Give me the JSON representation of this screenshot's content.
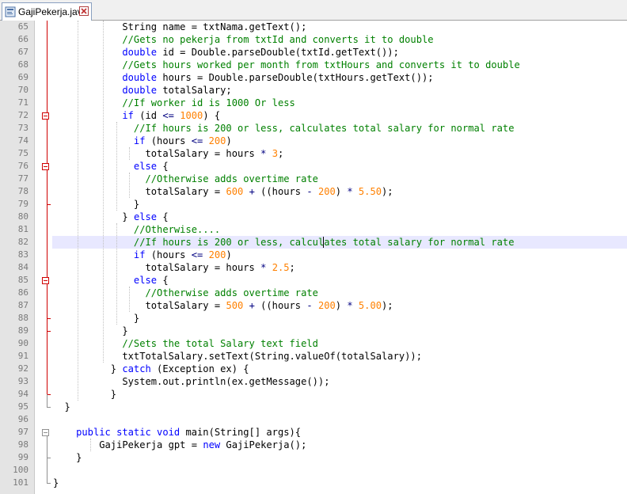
{
  "tab": {
    "label": "GajiPekerja.java",
    "icon": "java-file-icon",
    "close_icon": "close-icon"
  },
  "colors": {
    "keyword": "#0000ff",
    "comment": "#008000",
    "number": "#ff8000",
    "operator": "#000080",
    "fold_marker": "#d00000",
    "current_line": "#e8e8ff"
  },
  "editor": {
    "current_line": 82,
    "lines": [
      {
        "n": "65",
        "segs": [
          [
            "tx",
            "            String name = txtNama.getText();"
          ]
        ]
      },
      {
        "n": "66",
        "segs": [
          [
            "cm",
            "            //Gets no pekerja from txtId and converts it to double"
          ]
        ]
      },
      {
        "n": "67",
        "segs": [
          [
            "kw",
            "            double"
          ],
          [
            "tx",
            " id = Double.parseDouble(txtId.getText());"
          ]
        ]
      },
      {
        "n": "68",
        "segs": [
          [
            "cm",
            "            //Gets hours worked per month from txtHours and converts it to double"
          ]
        ]
      },
      {
        "n": "69",
        "segs": [
          [
            "kw",
            "            double"
          ],
          [
            "tx",
            " hours = Double.parseDouble(txtHours.getText());"
          ]
        ]
      },
      {
        "n": "70",
        "segs": [
          [
            "kw",
            "            double"
          ],
          [
            "tx",
            " totalSalary;"
          ]
        ]
      },
      {
        "n": "71",
        "segs": [
          [
            "cm",
            "            //If worker id is 1000 Or less"
          ]
        ]
      },
      {
        "n": "72",
        "segs": [
          [
            "kw",
            "            if"
          ],
          [
            "tx",
            " (id "
          ],
          [
            "op",
            "<="
          ],
          [
            "tx",
            " "
          ],
          [
            "nm",
            "1000"
          ],
          [
            "tx",
            ") {"
          ]
        ]
      },
      {
        "n": "73",
        "segs": [
          [
            "cm",
            "              //If hours is 200 or less, calculates total salary for normal rate"
          ]
        ]
      },
      {
        "n": "74",
        "segs": [
          [
            "kw",
            "              if"
          ],
          [
            "tx",
            " (hours "
          ],
          [
            "op",
            "<="
          ],
          [
            "tx",
            " "
          ],
          [
            "nm",
            "200"
          ],
          [
            "tx",
            ")"
          ]
        ]
      },
      {
        "n": "75",
        "segs": [
          [
            "tx",
            "                totalSalary = hours "
          ],
          [
            "op",
            "*"
          ],
          [
            "tx",
            " "
          ],
          [
            "nm",
            "3"
          ],
          [
            "tx",
            ";"
          ]
        ]
      },
      {
        "n": "76",
        "segs": [
          [
            "kw",
            "              else"
          ],
          [
            "tx",
            " {"
          ]
        ]
      },
      {
        "n": "77",
        "segs": [
          [
            "cm",
            "                //Otherwise adds overtime rate"
          ]
        ]
      },
      {
        "n": "78",
        "segs": [
          [
            "tx",
            "                totalSalary = "
          ],
          [
            "nm",
            "600"
          ],
          [
            "tx",
            " "
          ],
          [
            "op",
            "+"
          ],
          [
            "tx",
            " ((hours "
          ],
          [
            "op",
            "-"
          ],
          [
            "tx",
            " "
          ],
          [
            "nm",
            "200"
          ],
          [
            "tx",
            ") "
          ],
          [
            "op",
            "*"
          ],
          [
            "tx",
            " "
          ],
          [
            "nm",
            "5.50"
          ],
          [
            "tx",
            ");"
          ]
        ]
      },
      {
        "n": "79",
        "segs": [
          [
            "tx",
            "              }"
          ]
        ]
      },
      {
        "n": "80",
        "segs": [
          [
            "tx",
            "            } "
          ],
          [
            "kw",
            "else"
          ],
          [
            "tx",
            " {"
          ]
        ]
      },
      {
        "n": "81",
        "segs": [
          [
            "cm",
            "              //Otherwise...."
          ]
        ]
      },
      {
        "n": "82",
        "segs": [
          [
            "cm",
            "              //If hours is 200 or less, calculates total salary for normal rate"
          ]
        ]
      },
      {
        "n": "83",
        "segs": [
          [
            "kw",
            "              if"
          ],
          [
            "tx",
            " (hours "
          ],
          [
            "op",
            "<="
          ],
          [
            "tx",
            " "
          ],
          [
            "nm",
            "200"
          ],
          [
            "tx",
            ")"
          ]
        ]
      },
      {
        "n": "84",
        "segs": [
          [
            "tx",
            "                totalSalary = hours "
          ],
          [
            "op",
            "*"
          ],
          [
            "tx",
            " "
          ],
          [
            "nm",
            "2.5"
          ],
          [
            "tx",
            ";"
          ]
        ]
      },
      {
        "n": "85",
        "segs": [
          [
            "kw",
            "              else"
          ],
          [
            "tx",
            " {"
          ]
        ]
      },
      {
        "n": "86",
        "segs": [
          [
            "cm",
            "                //Otherwise adds overtime rate"
          ]
        ]
      },
      {
        "n": "87",
        "segs": [
          [
            "tx",
            "                totalSalary = "
          ],
          [
            "nm",
            "500"
          ],
          [
            "tx",
            " "
          ],
          [
            "op",
            "+"
          ],
          [
            "tx",
            " ((hours "
          ],
          [
            "op",
            "-"
          ],
          [
            "tx",
            " "
          ],
          [
            "nm",
            "200"
          ],
          [
            "tx",
            ") "
          ],
          [
            "op",
            "*"
          ],
          [
            "tx",
            " "
          ],
          [
            "nm",
            "5.00"
          ],
          [
            "tx",
            ");"
          ]
        ]
      },
      {
        "n": "88",
        "segs": [
          [
            "tx",
            "              }"
          ]
        ]
      },
      {
        "n": "89",
        "segs": [
          [
            "tx",
            "            }"
          ]
        ]
      },
      {
        "n": "90",
        "segs": [
          [
            "cm",
            "            //Sets the total Salary text field"
          ]
        ]
      },
      {
        "n": "91",
        "segs": [
          [
            "tx",
            "            txtTotalSalary.setText(String.valueOf(totalSalary));"
          ]
        ]
      },
      {
        "n": "92",
        "segs": [
          [
            "tx",
            "          } "
          ],
          [
            "kw",
            "catch"
          ],
          [
            "tx",
            " (Exception ex) {"
          ]
        ]
      },
      {
        "n": "93",
        "segs": [
          [
            "tx",
            "            System.out.println(ex.getMessage());"
          ]
        ]
      },
      {
        "n": "94",
        "segs": [
          [
            "tx",
            "          }"
          ]
        ]
      },
      {
        "n": "95",
        "segs": [
          [
            "tx",
            "  }"
          ]
        ]
      },
      {
        "n": "96",
        "segs": [
          [
            "tx",
            ""
          ]
        ]
      },
      {
        "n": "97",
        "segs": [
          [
            "kw",
            "    public static void"
          ],
          [
            "tx",
            " main(String[] args){"
          ]
        ]
      },
      {
        "n": "98",
        "segs": [
          [
            "tx",
            "        GajiPekerja gpt = "
          ],
          [
            "kw",
            "new"
          ],
          [
            "tx",
            " GajiPekerja();"
          ]
        ]
      },
      {
        "n": "99",
        "segs": [
          [
            "tx",
            "    }"
          ]
        ]
      },
      {
        "n": "100",
        "segs": [
          [
            "tx",
            ""
          ]
        ]
      },
      {
        "n": "101",
        "segs": [
          [
            "tx",
            "}"
          ]
        ]
      }
    ]
  }
}
